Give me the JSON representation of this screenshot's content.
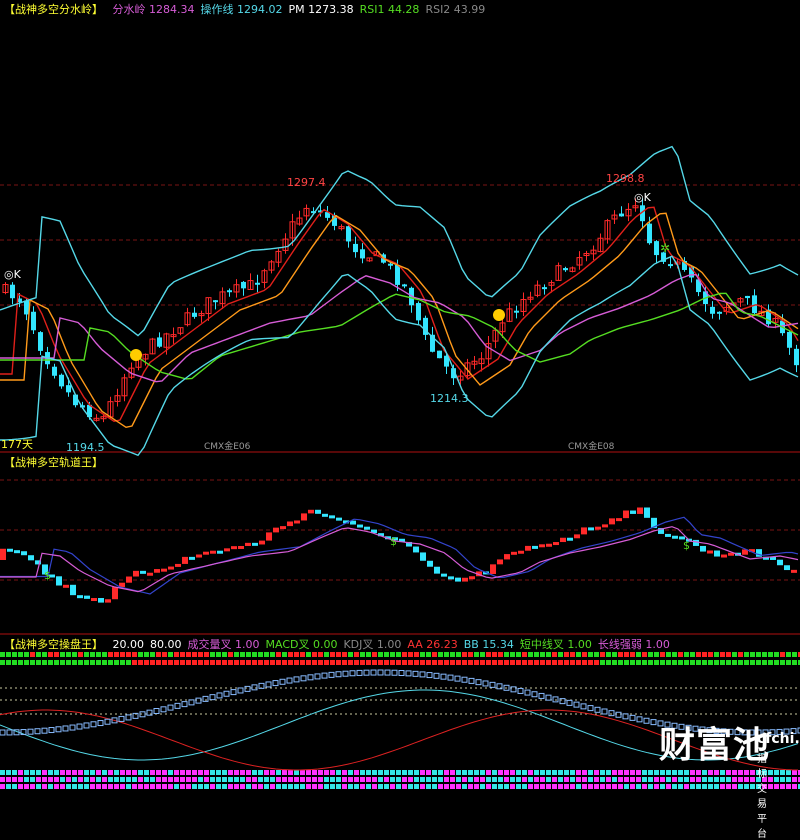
{
  "colors": {
    "up": "#ff2a2a",
    "down": "#33e6ff",
    "ma_cyan": "#55d8e8",
    "ma_magenta": "#d65cd6",
    "ma_orange": "#ff9a1a",
    "ma_green": "#55dd22",
    "ma_red": "#e0201a",
    "grid": "#7a1515",
    "divider": "#b01010",
    "title": "#ffff33"
  },
  "panel1": {
    "title": "【战神多空分水岭】",
    "items": [
      {
        "label": "分水岭",
        "value": "1284.34",
        "color": "#d65cd6"
      },
      {
        "label": "操作线",
        "value": "1294.02",
        "color": "#55d8e8"
      },
      {
        "label": "PM",
        "value": "1273.38",
        "color": "#ffffff"
      },
      {
        "label": "RSI1",
        "value": "44.28",
        "color": "#55dd22"
      },
      {
        "label": "RSI2",
        "value": "43.99",
        "color": "#888888"
      }
    ],
    "annotations": {
      "high_left": "1297.4",
      "high_right": "1298.8",
      "low_left": "1194.5",
      "low_mid": "1214.3",
      "k_left": "◎K",
      "k_right": "◎K",
      "days": "177天",
      "contract_1": "CMX金E06",
      "contract_2": "CMX金E08"
    }
  },
  "panel2": {
    "title": "【战神多空轨道王】",
    "dollar_sign": "$"
  },
  "panel3": {
    "title": "【战神多空操盘王】",
    "items": [
      {
        "label": "",
        "value": "20.00",
        "color": "#ffffff"
      },
      {
        "label": "",
        "value": "80.00",
        "color": "#ffffff"
      },
      {
        "label": "成交量叉",
        "value": "1.00",
        "color": "#d65cd6"
      },
      {
        "label": "MACD叉",
        "value": "0.00",
        "color": "#55dd22"
      },
      {
        "label": "KDJ叉",
        "value": "1.00",
        "color": "#888888"
      },
      {
        "label": "AA",
        "value": "26.23",
        "color": "#ff3333"
      },
      {
        "label": "BB",
        "value": "15.34",
        "color": "#55d8e8"
      },
      {
        "label": "短中线叉",
        "value": "1.00",
        "color": "#55dd22"
      },
      {
        "label": "长线强弱",
        "value": "1.00",
        "color": "#d65cd6"
      }
    ]
  },
  "watermark": {
    "brand": "财富池",
    "site": "cfchi.com",
    "tagline": "指标交易平台"
  }
}
